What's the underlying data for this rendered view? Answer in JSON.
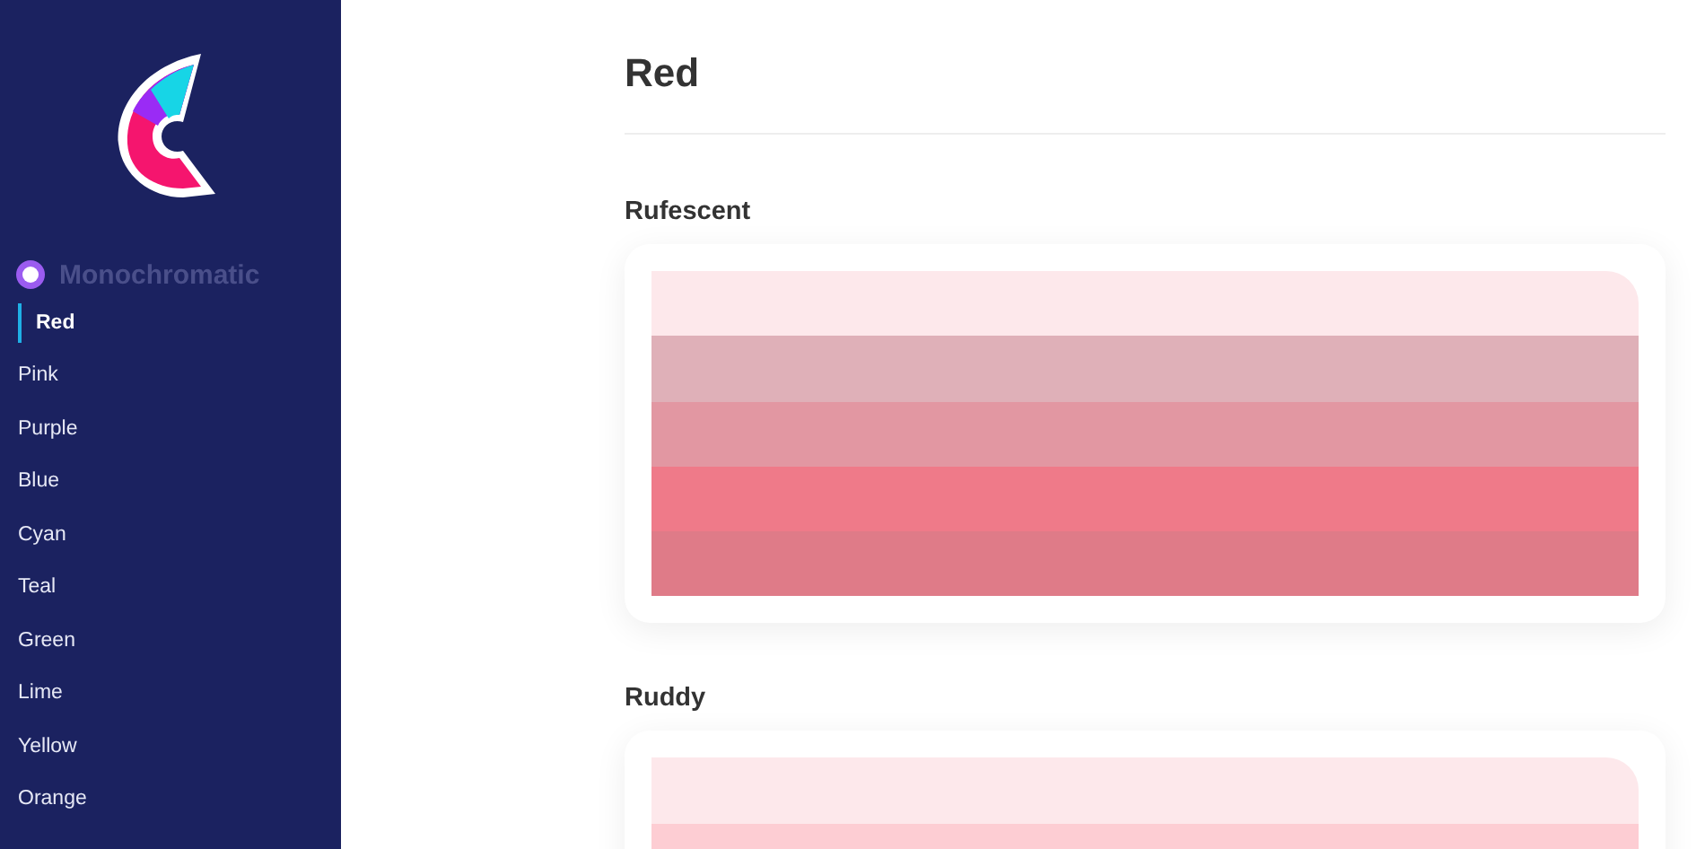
{
  "sidebar": {
    "section": {
      "label": "Monochromatic"
    },
    "items": [
      {
        "label": "Red",
        "selected": true
      },
      {
        "label": "Pink",
        "selected": false
      },
      {
        "label": "Purple",
        "selected": false
      },
      {
        "label": "Blue",
        "selected": false
      },
      {
        "label": "Cyan",
        "selected": false
      },
      {
        "label": "Teal",
        "selected": false
      },
      {
        "label": "Green",
        "selected": false
      },
      {
        "label": "Lime",
        "selected": false
      },
      {
        "label": "Yellow",
        "selected": false
      },
      {
        "label": "Orange",
        "selected": false
      }
    ]
  },
  "page": {
    "title": "Red",
    "palettes": [
      {
        "name": "Rufescent",
        "swatches": [
          {
            "color": "#fde8eb"
          },
          {
            "color": "#dfb0b8"
          },
          {
            "color": "#e297a2"
          },
          {
            "color": "#ef7a89"
          },
          {
            "color": "#df7b88"
          }
        ]
      },
      {
        "name": "Ruddy",
        "swatches": [
          {
            "color": "#fde8eb"
          },
          {
            "color": "#fdcdd3"
          }
        ]
      }
    ]
  }
}
